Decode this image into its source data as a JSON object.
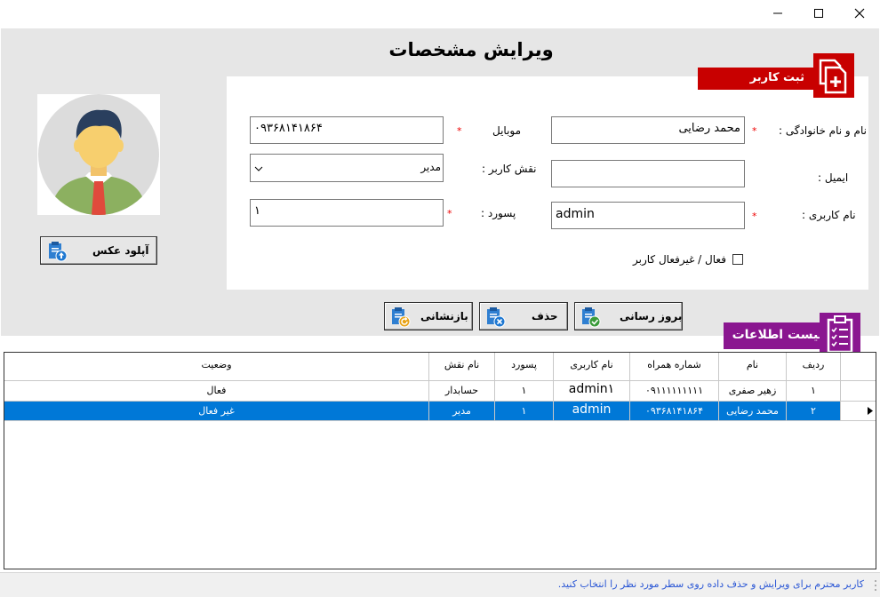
{
  "window": {
    "minimize": "—",
    "maximize": "☐",
    "close": "✕"
  },
  "page": {
    "title": "ویرایش مشخصات"
  },
  "register_section": {
    "title": "ثبت کاربر",
    "icon": "document-add-icon"
  },
  "form": {
    "fullname": {
      "label": "نام و نام خانوادگی :",
      "value": "محمد رضایی",
      "required": "*"
    },
    "mobile": {
      "label": "موبایل",
      "value": "۰۹۳۶۸۱۴۱۸۶۴",
      "required": "*"
    },
    "email": {
      "label": "ایمیل :",
      "value": ""
    },
    "role": {
      "label": "نقش کاربر :",
      "value": "مدیر"
    },
    "username": {
      "label": "نام کاربری :",
      "value": "admin",
      "required": "*"
    },
    "password": {
      "label": "پسورد :",
      "value": "۱",
      "required": "*"
    },
    "active": {
      "label": "فعال / غیرفعال کاربر",
      "checked": false
    }
  },
  "avatar": {
    "upload_label": "آپلود عکس"
  },
  "actions": {
    "update": "بروز رسانی",
    "delete": "حذف",
    "reset": "بازنشانی"
  },
  "list_section": {
    "title": "لیست اطلاعات",
    "icon": "checklist-icon"
  },
  "table": {
    "headers": {
      "row": "ردیف",
      "name": "نام",
      "phone": "شماره همراه",
      "username": "نام کاربری",
      "password": "پسورد",
      "role": "نام نقش",
      "status": "وضعیت"
    },
    "rows": [
      {
        "row": "۱",
        "name": "زهیر صفری",
        "phone": "۰۹۱۱۱۱۱۱۱۱۱",
        "username": "admin۱",
        "password": "۱",
        "role": "حسابدار",
        "status": "فعال"
      },
      {
        "row": "۲",
        "name": "محمد رضایی",
        "phone": "۰۹۳۶۸۱۴۱۸۶۴",
        "username": "admin",
        "password": "۱",
        "role": "مدیر",
        "status": "غیر فعال"
      }
    ]
  },
  "statusbar": {
    "text": "کاربر محترم برای ویرایش و حذف داده روی سطر مورد نظر را انتخاب کنید."
  },
  "colors": {
    "red": "#c80000",
    "purple": "#8a1690",
    "selection": "#0078d7",
    "hint": "#2b57d5"
  }
}
